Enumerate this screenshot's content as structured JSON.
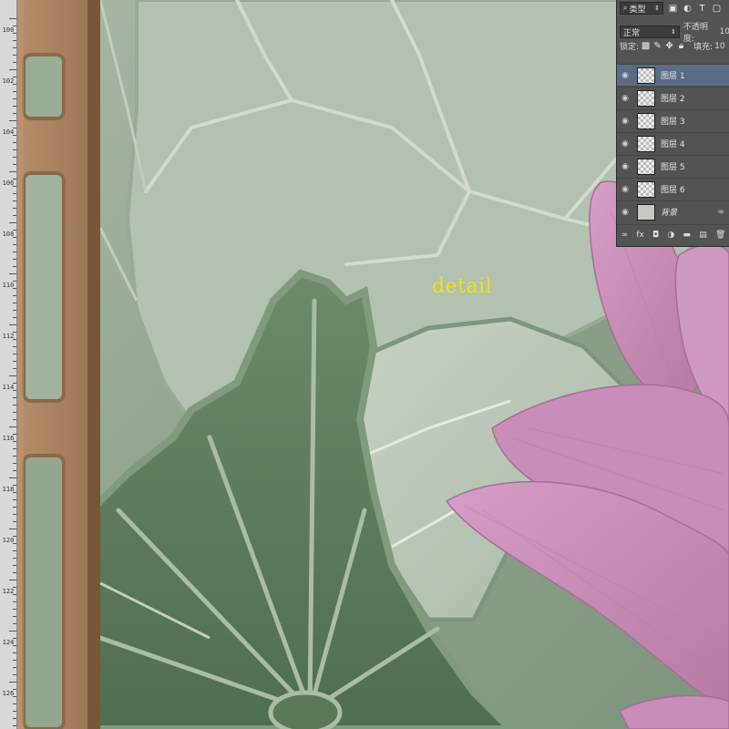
{
  "overlay_text": "detail",
  "ruler": {
    "labels": [
      "100",
      "102",
      "104",
      "106",
      "108",
      "110",
      "112",
      "114",
      "116",
      "118",
      "120",
      "122",
      "124",
      "126"
    ]
  },
  "layers_panel": {
    "kind_filter": "类型",
    "blend_mode": "正常",
    "opacity_label": "不透明度:",
    "opacity_value": "10",
    "lock_label": "锁定:",
    "fill_label": "填充:",
    "fill_value": "10",
    "layers": [
      {
        "name": "图层 1",
        "selected": true
      },
      {
        "name": "图层 2",
        "selected": false
      },
      {
        "name": "图层 3",
        "selected": false
      },
      {
        "name": "图层 4",
        "selected": false
      },
      {
        "name": "图层 5",
        "selected": false
      },
      {
        "name": "图层 6",
        "selected": false
      },
      {
        "name": "背景",
        "selected": false,
        "italic": true
      }
    ]
  },
  "colors": {
    "leaf_light": "#b6c4b3",
    "leaf_dark": "#5f7e5e",
    "vein": "#d5dccf",
    "petal": "#c88cb6",
    "frame": "#a8825f",
    "frame_dark": "#7a5637",
    "selection": "#5a6c84",
    "overlay_text": "#f2e21a"
  }
}
